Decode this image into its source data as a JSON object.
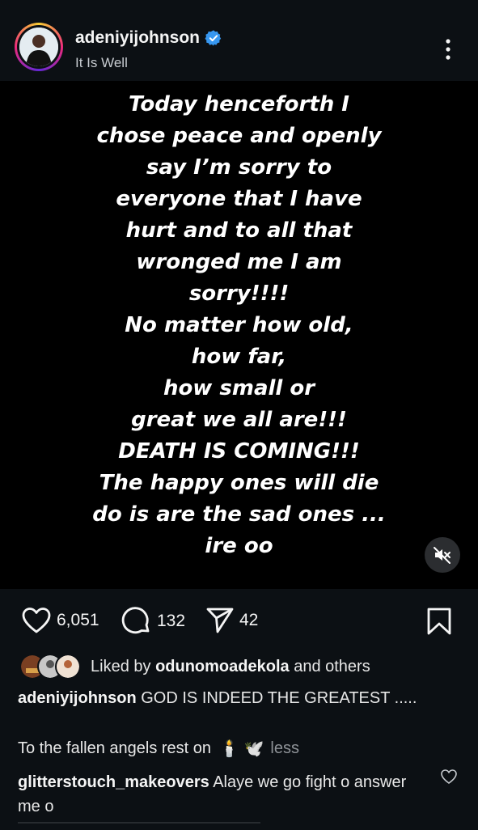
{
  "header": {
    "username": "adeniyijohnson",
    "subtitle": "It Is Well"
  },
  "media": {
    "text": "Today henceforth I\nchose peace and openly\nsay I’m sorry to\neveryone that I have\nhurt and to all that\nwronged me I am\nsorry!!!!\nNo matter how old,\nhow far,\nhow small or\ngreat we all are!!!\nDEATH IS COMING!!!\nThe happy ones will die\ndo is are the sad ones ...\nire oo"
  },
  "actions": {
    "like_count": "6,051",
    "comment_count": "132",
    "share_count": "42"
  },
  "likes": {
    "prefix": "Liked by",
    "user": "odunomoadekola",
    "suffix": "and others"
  },
  "caption": {
    "user": "adeniyijohnson",
    "text": "GOD IS INDEED THE GREATEST .....",
    "line2": "To the fallen angels rest on",
    "emojis": "🕯️ 🕊️",
    "less_label": "less"
  },
  "comment": {
    "user": "glitterstouch_makeovers",
    "text": "Alaye we go fight o answer me o"
  },
  "icons": {
    "verified": "verified-badge-icon",
    "more": "more-vertical-icon",
    "mute": "speaker-muted-icon",
    "like": "heart-outline-icon",
    "comment": "comment-bubble-icon",
    "share": "paper-plane-icon",
    "save": "bookmark-icon"
  },
  "colors": {
    "background": "#0c1014",
    "verified": "#3797f0",
    "text_primary": "#f5f5f5",
    "text_secondary": "#c7cbd0"
  }
}
